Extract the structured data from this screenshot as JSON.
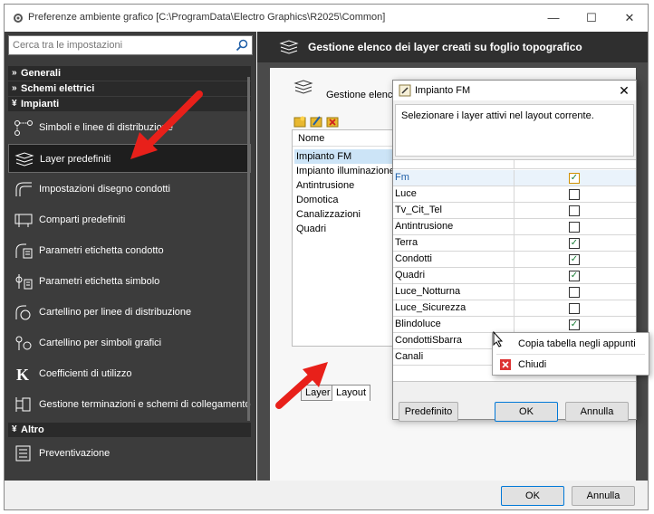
{
  "window": {
    "title": "Preferenze ambiente grafico [C:\\ProgramData\\Electro Graphics\\R2025\\Common]",
    "minimize": "—",
    "maximize": "☐",
    "close": "✕"
  },
  "search": {
    "placeholder": "Cerca tra le impostazioni"
  },
  "sections": {
    "generali": "Generali",
    "schemi": "Schemi elettrici",
    "impianti": "Impianti",
    "altro": "Altro"
  },
  "menu": {
    "simboli": "Simboli e linee di distribuzione",
    "layer": "Layer predefiniti",
    "impostazioni": "Impostazioni disegno condotti",
    "comparti": "Comparti predefiniti",
    "parametri_condotto": "Parametri etichetta condotto",
    "parametri_simbolo": "Parametri etichetta simbolo",
    "cartellino_linee": "Cartellino per linee di distribuzione",
    "cartellino_simboli": "Cartellino per simboli grafici",
    "coefficienti": "Coefficienti di utilizzo",
    "gestione_terminazioni": "Gestione terminazioni e schemi di collegamento",
    "preventivazione": "Preventivazione"
  },
  "right": {
    "header_title": "Gestione elenco dei layer creati su foglio topografico",
    "inner_label": "Gestione elenco d",
    "list_header": "Nome",
    "layers": [
      "Impianto FM",
      "Impianto illuminazione",
      "Antintrusione",
      "Domotica",
      "Canalizzazioni",
      "Quadri"
    ],
    "tab_layer": "Layer",
    "tab_layout": "Layout"
  },
  "bottom": {
    "ok": "OK",
    "cancel": "Annulla"
  },
  "dialog": {
    "title": "Impianto FM",
    "close": "✕",
    "description": "Selezionare i layer attivi nel layout corrente.",
    "rows": [
      {
        "name": "Fm",
        "checked": true
      },
      {
        "name": "Luce",
        "checked": false
      },
      {
        "name": "Tv_Cit_Tel",
        "checked": false
      },
      {
        "name": "Antintrusione",
        "checked": false
      },
      {
        "name": "Terra",
        "checked": true
      },
      {
        "name": "Condotti",
        "checked": true
      },
      {
        "name": "Quadri",
        "checked": true
      },
      {
        "name": "Luce_Notturna",
        "checked": false
      },
      {
        "name": "Luce_Sicurezza",
        "checked": false
      },
      {
        "name": "Blindoluce",
        "checked": true
      },
      {
        "name": "CondottiSbarra",
        "checked": false
      },
      {
        "name": "Canali",
        "checked": false
      }
    ],
    "btn_default": "Predefinito",
    "btn_ok": "OK",
    "btn_cancel": "Annulla"
  },
  "context_menu": {
    "copy": "Copia tabella negli appunti",
    "close": "Chiudi"
  },
  "colors": {
    "accent": "#0078d7",
    "arrow": "#e8201a",
    "dark_panel": "#3c3c3c"
  }
}
